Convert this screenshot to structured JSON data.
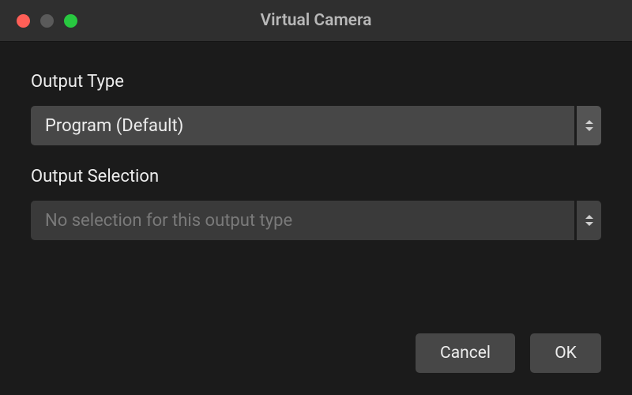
{
  "window": {
    "title": "Virtual Camera"
  },
  "fields": {
    "outputType": {
      "label": "Output Type",
      "value": "Program (Default)"
    },
    "outputSelection": {
      "label": "Output Selection",
      "value": "No selection for this output type"
    }
  },
  "buttons": {
    "cancel": "Cancel",
    "ok": "OK"
  }
}
